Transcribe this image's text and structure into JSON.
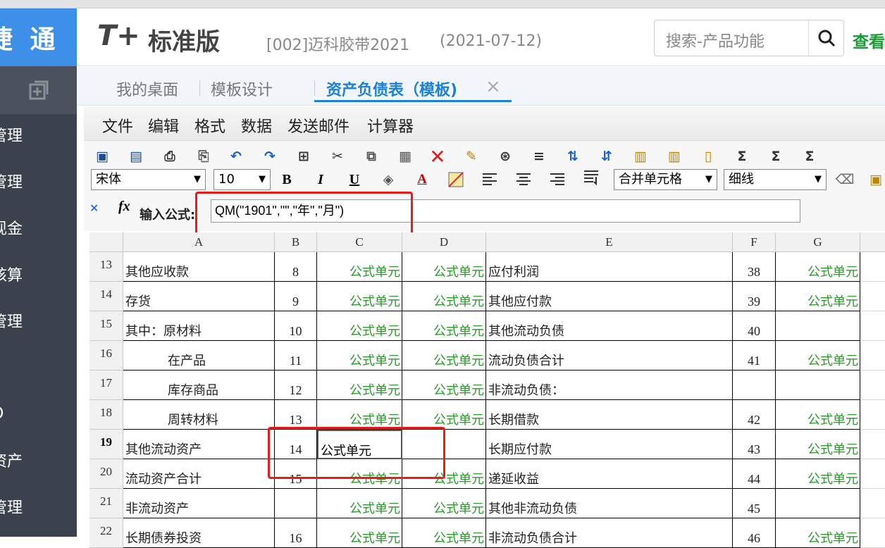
{
  "app": {
    "logo_text": "捷 通",
    "brand_t": "T+",
    "brand_text": "标准版",
    "account": "[002]迈科胶带2021",
    "date": "(2021-07-12)",
    "search_placeholder": "搜索-产品功能",
    "view_link": "查看"
  },
  "sidebar": {
    "items": [
      "管理",
      "管理",
      "现金",
      "核算",
      "管理",
      "O",
      "资产",
      "管理"
    ]
  },
  "tabs": [
    {
      "label": "我的桌面",
      "active": false
    },
    {
      "label": "模板设计",
      "active": false
    },
    {
      "label": "资产负债表（模板)",
      "active": true
    }
  ],
  "tab_close": "×",
  "menu": [
    "文件",
    "编辑",
    "格式",
    "数据",
    "发送邮件",
    "计算器"
  ],
  "toolbar": {
    "font": "宋体",
    "size": "10",
    "merge": "合并单元格",
    "line": "细线",
    "bold": "B",
    "italic": "I",
    "underline": "U"
  },
  "formula": {
    "label": "输入公式:",
    "fx": "fx",
    "value": "QM(\"1901\",\"\",\"年\",\"月\")"
  },
  "columns": [
    "A",
    "B",
    "C",
    "D",
    "E",
    "F",
    "G"
  ],
  "rows": [
    {
      "n": "13",
      "a": "其他应收款",
      "b": "8",
      "c": "公式单元",
      "d": "公式单元",
      "e": "应付利润",
      "f": "38",
      "g": "公式单元"
    },
    {
      "n": "14",
      "a": "存货",
      "b": "9",
      "c": "公式单元",
      "d": "公式单元",
      "e": "其他应付款",
      "f": "39",
      "g": "公式单元"
    },
    {
      "n": "15",
      "a": "其中：原材料",
      "b": "10",
      "c": "公式单元",
      "d": "公式单元",
      "e": "其他流动负债",
      "f": "40",
      "g": ""
    },
    {
      "n": "16",
      "a": "在产品",
      "b": "11",
      "c": "公式单元",
      "d": "公式单元",
      "e": "流动负债合计",
      "f": "41",
      "g": "公式单元"
    },
    {
      "n": "17",
      "a": "库存商品",
      "b": "12",
      "c": "公式单元",
      "d": "公式单元",
      "e": "非流动负债：",
      "f": "",
      "g": ""
    },
    {
      "n": "18",
      "a": "周转材料",
      "b": "13",
      "c": "公式单元",
      "d": "公式单元",
      "e": "长期借款",
      "f": "42",
      "g": "公式单元"
    },
    {
      "n": "19",
      "a": "其他流动资产",
      "b": "14",
      "c": "公式单元",
      "d": "",
      "e": "长期应付款",
      "f": "43",
      "g": "公式单元"
    },
    {
      "n": "20",
      "a": "流动资产合计",
      "b": "15",
      "c": "公式单元",
      "d": "公式单元",
      "e": "递延收益",
      "f": "44",
      "g": "公式单元"
    },
    {
      "n": "21",
      "a": "非流动资产",
      "b": "",
      "c": "公式单元",
      "d": "公式单元",
      "e": "其他非流动负债",
      "f": "45",
      "g": ""
    },
    {
      "n": "22",
      "a": "长期债券投资",
      "b": "16",
      "c": "公式单元",
      "d": "公式单元",
      "e": "非流动负债合计",
      "f": "46",
      "g": "公式单元"
    }
  ]
}
